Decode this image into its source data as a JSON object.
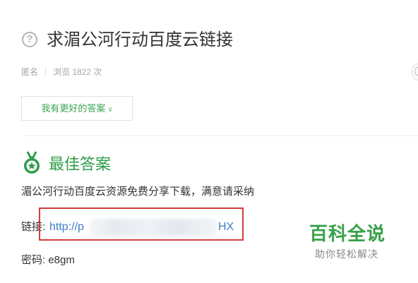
{
  "question": {
    "icon": "question-circle-icon",
    "title": "求湄公河行动百度云链接"
  },
  "meta": {
    "author": "匿名",
    "views_label": "浏览",
    "views_count": "1822",
    "views_unit": "次"
  },
  "better_answer_button": {
    "label": "我有更好的答案",
    "icon": "chevron-down-icon"
  },
  "best_answer": {
    "icon": "medal-icon",
    "heading": "最佳答案",
    "intro": "湄公河行动百度云资源免费分享下载，满意请采纳",
    "link_label": "链接:",
    "link_start": "http://p",
    "link_end": "HX",
    "password_label": "密码:",
    "password_value": "e8gm"
  },
  "watermark": {
    "title": "百科全说",
    "subtitle": "助你轻松解决"
  },
  "colors": {
    "accent_green": "#2f9d4b",
    "link_blue": "#3e7dc8",
    "highlight_red": "#d13c3c"
  }
}
